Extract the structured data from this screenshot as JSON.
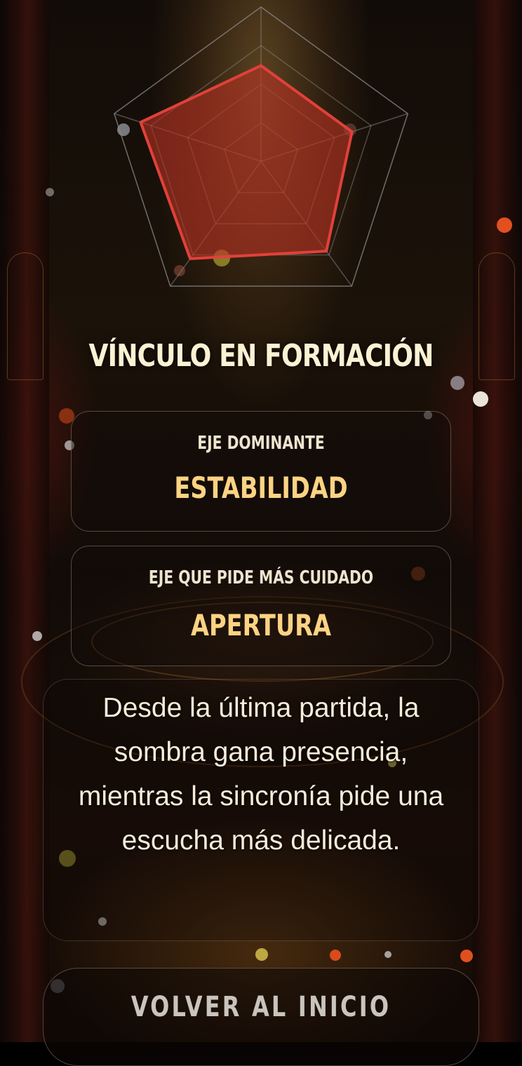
{
  "colors": {
    "background": "#120c08",
    "title": "#fdf1d3",
    "accent_value": "#fbd383",
    "label": "#efe4cf",
    "radar_fill": "#b53224",
    "radar_stroke": "#e0413a",
    "grid": "#8c8c8c"
  },
  "radar": {
    "axes": 5,
    "levels": 4,
    "max": 1,
    "values": [
      0.62,
      0.62,
      0.72,
      0.78,
      0.82
    ]
  },
  "result": {
    "title": "VÍNCULO EN FORMACIÓN"
  },
  "dominant_axis": {
    "label": "EJE DOMINANTE",
    "value": "ESTABILIDAD"
  },
  "care_axis": {
    "label": "EJE QUE PIDE MÁS CUIDADO",
    "value": "APERTURA"
  },
  "narrative": {
    "text": "Desde la última partida, la sombra gana presencia, mientras la sincronía pide una escucha más delicada."
  },
  "actions": {
    "home_label": "VOLVER AL INICIO"
  }
}
